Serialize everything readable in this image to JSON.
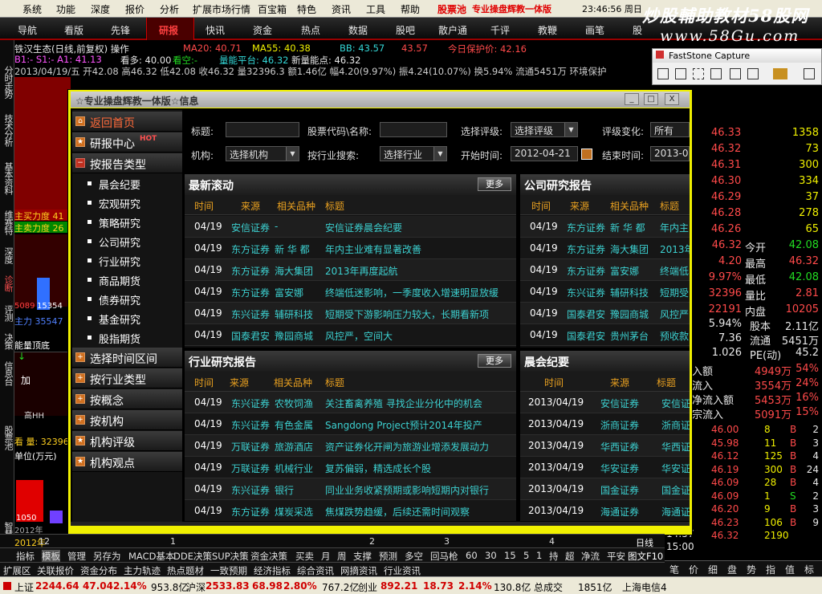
{
  "menubar": {
    "items": [
      "系统",
      "功能",
      "深度",
      "报价",
      "分析",
      "扩展市场行情",
      "百宝箱",
      "特色",
      "资讯",
      "工具",
      "帮助"
    ],
    "stockpool": "股票池",
    "adtext": "专业操盘辉教一体版",
    "clock": "23:46:56 周日"
  },
  "brand": {
    "line1": "炒股輔助教材58股网",
    "line2": "www.58Gu.com"
  },
  "navbar": {
    "tabs": [
      "导航",
      "看版",
      "先锋",
      "研报",
      "快讯",
      "资金",
      "热点",
      "数据",
      "股吧",
      "散户通",
      "千评",
      "教鞭",
      "画笔",
      "股"
    ]
  },
  "info": {
    "line1": "铁汉生态(日线,前复权) 操作",
    "ma20": "MA20: 40.71",
    "ma55": "MA55: 40.38",
    "bb": "BB: 43.57",
    "bb2": "43.57",
    "bao": "今日保护价: 42.16",
    "b1": "B1:- S1:- A1: 41.13",
    "kd": "看多: 40.00",
    "kk": "看空:-",
    "pt": "量能平台: 46.32",
    "xg": "新量能点: 46.32",
    "line3": "2013/04/19/五 开42.08 高46.32 低42.08 收46.32 量32396.3 额1.46亿 幅4.20(9.97%) 振4.24(10.07%) 换5.94% 流通5451万 环境保护"
  },
  "vtabs": [
    "分时走势",
    "技术分析",
    "基本资料",
    "维赛特",
    "深度",
    "诊断",
    "评测",
    "决策",
    "信息台",
    "股票池",
    "智慧"
  ],
  "chartLeft": {
    "buy": "主买力度 41",
    "sell": "主卖力度 26",
    "vol": "5089",
    "vol2": "15354",
    "big": "主力 35547",
    "label1": "能量顶底",
    "jia": "加",
    "gaohe": "高HH",
    "kan": "看 量: 32396",
    "unit": "单位(万元)",
    "last": "1050",
    "year": "2012年"
  },
  "dialog": {
    "title": "☆专业操盘辉教一体版☆信息",
    "btns": [
      "_",
      "□",
      "X"
    ]
  },
  "sidebar": {
    "home": "返回首页",
    "center": "研报中心",
    "hot": "HOT",
    "reporttype": "按报告类型",
    "subs": [
      "晨会纪要",
      "宏观研究",
      "策略研究",
      "公司研究",
      "行业研究",
      "商品期货",
      "债券研究",
      "基金研究",
      "股指期货"
    ],
    "more": [
      "选择时间区间",
      "按行业类型",
      "按概念",
      "按机构",
      "机构评级",
      "机构观点"
    ]
  },
  "filters": {
    "title_label": "标题:",
    "code_label": "股票代码\\名称:",
    "rating_label": "选择评级:",
    "rating_value": "选择评级",
    "change_label": "评级变化:",
    "change_value": "所有",
    "org_label": "机构:",
    "org_value": "选择机构",
    "ind_label": "按行业搜索:",
    "ind_value": "选择行业",
    "start_label": "开始时间:",
    "start_value": "2012-04-21",
    "end_label": "结束时间:",
    "end_value": "2013-04-"
  },
  "latest": {
    "title": "最新滚动",
    "more": "更多",
    "cols": [
      "时间",
      "来源",
      "相关品种",
      "标题"
    ],
    "rows": [
      [
        "04/19",
        "安信证券",
        "-",
        "安信证券晨会纪要"
      ],
      [
        "04/19",
        "东方证券",
        "新 华 都",
        "年内主业难有显著改善"
      ],
      [
        "04/19",
        "东方证券",
        "海大集团",
        "2013年再度起航"
      ],
      [
        "04/19",
        "东方证券",
        "富安娜",
        "终端低迷影响，一季度收入增速明显放缓"
      ],
      [
        "04/19",
        "东兴证券",
        "辅研科技",
        "短期受下游影响压力较大，长期看新项"
      ],
      [
        "04/19",
        "国泰君安",
        "豫园商城",
        "风控严，空间大"
      ]
    ]
  },
  "company": {
    "title": "公司研究报告",
    "cols": [
      "时间",
      "来源",
      "相关品种",
      "标题"
    ],
    "rows": [
      [
        "04/19",
        "东方证券",
        "新 华 都",
        "年内主"
      ],
      [
        "04/19",
        "东方证券",
        "海大集团",
        "2013年"
      ],
      [
        "04/19",
        "东方证券",
        "富安娜",
        "终端低"
      ],
      [
        "04/19",
        "东兴证券",
        "辅研科技",
        "短期受"
      ],
      [
        "04/19",
        "国泰君安",
        "豫园商城",
        "风控严"
      ],
      [
        "04/19",
        "国泰君安",
        "贵州茅台",
        "预收款"
      ]
    ]
  },
  "industry": {
    "title": "行业研究报告",
    "more": "更多",
    "cols": [
      "时间",
      "来源",
      "相关品种",
      "标题"
    ],
    "rows": [
      [
        "04/19",
        "东兴证券",
        "农牧饲渔",
        "关注畜禽养殖 寻找企业分化中的机会"
      ],
      [
        "04/19",
        "东兴证券",
        "有色金属",
        "Sangdong Project预计2014年投产"
      ],
      [
        "04/19",
        "万联证券",
        "旅游酒店",
        "资产证券化开闸为旅游业增添发展动力"
      ],
      [
        "04/19",
        "万联证券",
        "机械行业",
        "复苏偏弱，精选成长个股"
      ],
      [
        "04/19",
        "东兴证券",
        "银行",
        "同业业务收紧预期或影响短期内对银行"
      ],
      [
        "04/19",
        "东方证券",
        "煤炭采选",
        "焦煤跌势趋缓，后续还需时间观察"
      ]
    ]
  },
  "morning": {
    "title": "晨会纪要",
    "cols": [
      "时间",
      "来源",
      "标题"
    ],
    "rows": [
      [
        "2013/04/19",
        "安信证券",
        "安信证"
      ],
      [
        "2013/04/19",
        "浙商证券",
        "浙商证"
      ],
      [
        "2013/04/19",
        "华西证券",
        "华西证"
      ],
      [
        "2013/04/19",
        "华安证券",
        "华安证"
      ],
      [
        "2013/04/19",
        "国金证券",
        "国金证"
      ],
      [
        "2013/04/19",
        "海通证券",
        "海通证"
      ]
    ]
  },
  "fastone": {
    "title": "FastStone Capture"
  },
  "quotes": {
    "prices": [
      "46.33",
      "46.32",
      "46.31",
      "46.30",
      "46.29",
      "46.28",
      "46.26"
    ],
    "vols": [
      "1358",
      "73",
      "300",
      "334",
      "37",
      "278",
      "65"
    ],
    "stats": [
      [
        "46.32",
        "今开",
        "42.08"
      ],
      [
        "4.20",
        "最高",
        "46.32"
      ],
      [
        "9.97%",
        "最低",
        "42.08"
      ],
      [
        "32396",
        "量比",
        "2.81"
      ],
      [
        "22191",
        "内盘",
        "10205"
      ]
    ],
    "stats2": [
      [
        "5.94%",
        "股本",
        "2.11亿"
      ],
      [
        "7.36",
        "流通",
        "5451万"
      ],
      [
        "1.026",
        "PE(动)",
        "45.2"
      ]
    ],
    "flows": [
      [
        "入额",
        "4949万",
        "54%"
      ],
      [
        "流入",
        "3554万",
        "24%"
      ],
      [
        "净流入额",
        "5453万",
        "16%"
      ],
      [
        "宗流入",
        "5091万",
        "15%"
      ]
    ],
    "ticks": [
      [
        "46.00",
        "8",
        "B",
        "2"
      ],
      [
        "45.98",
        "11",
        "B",
        "3"
      ],
      [
        "46.12",
        "125",
        "B",
        "4"
      ],
      [
        "46.19",
        "300",
        "B",
        "24"
      ],
      [
        "46.09",
        "28",
        "B",
        "4"
      ],
      [
        "46.09",
        "1",
        "S",
        "2"
      ],
      [
        "46.20",
        "9",
        "B",
        "3"
      ],
      [
        "46.23",
        "106",
        "B",
        "9"
      ],
      [
        "46.32",
        "2190",
        "",
        ""
      ]
    ],
    "times": [
      "14:57",
      "15:00"
    ]
  },
  "rtabs": [
    "笔",
    "价",
    "细",
    "盘",
    "势",
    "指",
    "值",
    "标"
  ],
  "tool1": {
    "labels": [
      "指标",
      "模板",
      "管理",
      "另存为",
      "MACD基本",
      "DDE决策",
      "SUP决策",
      "资金决策",
      "买卖",
      "月",
      "周",
      "支撑",
      "预测",
      "多空",
      "回马枪",
      "60",
      "30",
      "15",
      "5",
      "1",
      "持",
      "超",
      "净流",
      "平安"
    ],
    "axis": [
      "12",
      "1",
      "2",
      "3",
      "4"
    ],
    "rtab": "日线",
    "rtab2": "图文F10"
  },
  "tool2": {
    "labels": [
      "扩展区",
      "关联报价",
      "资金分布",
      "主力轨迹",
      "热点题材",
      "一致预期",
      "经济指标",
      "综合资讯",
      "网摘资讯",
      "行业资讯"
    ]
  },
  "status": {
    "sh_label": "上证",
    "sh_val": "2244.64",
    "sh_chg": "47.04",
    "sh_pct": "2.14%",
    "sh_amt": "953.8亿",
    "sz_label": "沪深",
    "sz_val": "2533.83",
    "sz_chg": "68.98",
    "sz_pct": "2.80%",
    "sz_amt": "767.2亿",
    "cy_label": "创业",
    "cy_val": "892.21",
    "cy_chg": "18.73",
    "cy_pct": "2.14%",
    "cy_amt": "130.8亿",
    "total": "总成交",
    "total_val": "1851亿",
    "isp": "上海电信4"
  }
}
